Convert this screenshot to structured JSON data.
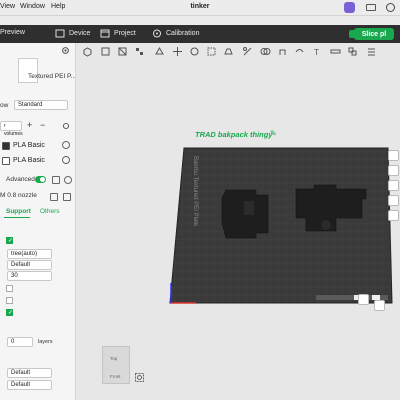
{
  "menubar": {
    "items": [
      "View",
      "Window",
      "Help"
    ],
    "app_title": "tinker"
  },
  "toolbar": {
    "tabs": [
      "Preview",
      "Project",
      "Device",
      "Calibration"
    ],
    "slice_label": "Slice pl"
  },
  "sidebar": {
    "plate_type": "Textured PEI P...",
    "process_prefix": "ow",
    "process_value": "Standard",
    "objects_label": "r volumes",
    "filaments": [
      "PLA Basic",
      "PLA Basic"
    ],
    "advanced_label": "Advanced",
    "nozzle_label": "M 0.8 nozzle",
    "tab_support": "Support",
    "tab_others": "Others",
    "support_type": "tree(auto)",
    "support_style": "Default",
    "threshold_angle": "30",
    "raft_layers": "0",
    "layers_unit": "layers",
    "default_1": "Default",
    "default_2": "Default"
  },
  "canvas": {
    "plate_name": "TRAD bakpack thingy",
    "bed_label": "Bambu Textured PEI Plate",
    "navcube_top": "Top",
    "navcube_front": "Front"
  },
  "colors": {
    "accent": "#19a84e",
    "toolbar_bg": "#2f2f2f",
    "bed": "#3a3a3a"
  }
}
